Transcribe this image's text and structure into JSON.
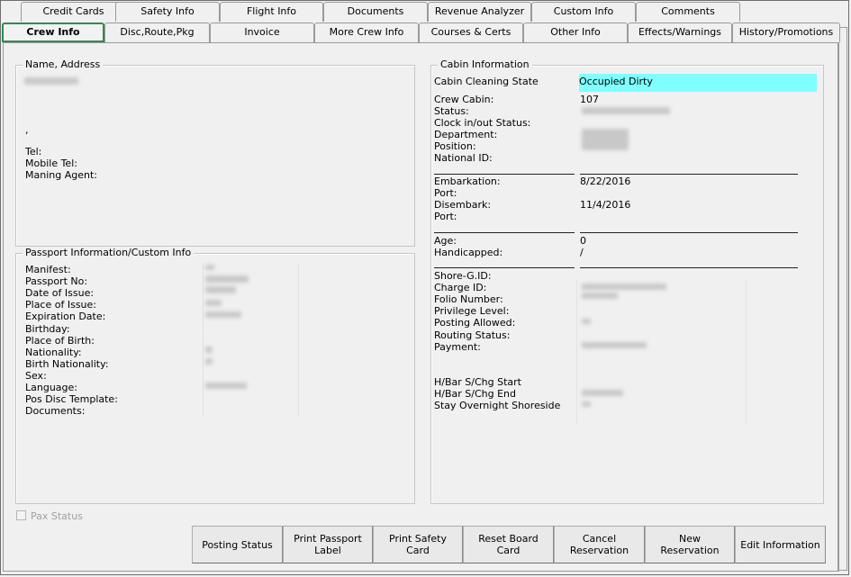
{
  "tabs": {
    "row1": [
      {
        "label": "Credit Cards"
      },
      {
        "label": "Safety Info"
      },
      {
        "label": "Flight Info"
      },
      {
        "label": "Documents"
      },
      {
        "label": "Revenue Analyzer"
      },
      {
        "label": "Custom Info"
      },
      {
        "label": "Comments"
      }
    ],
    "row2": [
      {
        "label": "Crew Info",
        "active": true
      },
      {
        "label": "Disc,Route,Pkg"
      },
      {
        "label": "Invoice"
      },
      {
        "label": "More Crew Info"
      },
      {
        "label": "Courses & Certs"
      },
      {
        "label": "Other Info"
      },
      {
        "label": "Effects/Warnings"
      },
      {
        "label": "History/Promotions"
      }
    ]
  },
  "name_address": {
    "title": "Name, Address",
    "comma": ",",
    "labels": {
      "tel": "Tel:",
      "mobile_tel": "Mobile Tel:",
      "maning_agent": "Maning Agent:"
    }
  },
  "passport": {
    "title": "Passport Information/Custom Info",
    "labels": [
      "Manifest:",
      "Passport No:",
      "Date of Issue:",
      "Place of Issue:",
      "Expiration Date:",
      "Birthday:",
      "Place of Birth:",
      "Nationality:",
      "Birth Nationality:",
      "Sex:",
      "Language:",
      "Pos Disc Template:",
      "Documents:"
    ]
  },
  "cabin": {
    "title": "Cabin Information",
    "cleaning_state_label": "Cabin Cleaning State",
    "cleaning_state_value": "Occupied Dirty",
    "cleaning_state_color": "#7fffff",
    "group1": {
      "labels": [
        "Crew Cabin:",
        "Status:",
        "Clock in/out Status:",
        "Department:",
        "Position:",
        "National ID:"
      ],
      "crew_cabin": "107"
    },
    "group2": {
      "labels": [
        "Embarkation:",
        "Port:",
        "Disembark:",
        "Port:"
      ],
      "embarkation": "8/22/2016",
      "disembark": "11/4/2016"
    },
    "group3": {
      "labels": [
        "Age:",
        "Handicapped:"
      ],
      "age": "0",
      "handicapped": "/"
    },
    "group4": {
      "labels": [
        "Shore-G.ID:",
        "Charge ID:",
        "Folio Number:",
        "Privilege Level:",
        "Posting Allowed:",
        "Routing Status:",
        "Payment:"
      ]
    },
    "group5": {
      "labels": [
        "H/Bar S/Chg Start",
        "H/Bar S/Chg End",
        "Stay Overnight Shoreside"
      ]
    }
  },
  "pax_status": {
    "label": "Pax Status",
    "checked": false,
    "enabled": false
  },
  "buttons": [
    {
      "label": "Posting Status"
    },
    {
      "label": "Print Passport Label"
    },
    {
      "label": "Print Safety Card"
    },
    {
      "label": "Reset Board Card"
    },
    {
      "label": "Cancel Reservation"
    },
    {
      "label": "New Reservation"
    },
    {
      "label": "Edit Information"
    }
  ]
}
